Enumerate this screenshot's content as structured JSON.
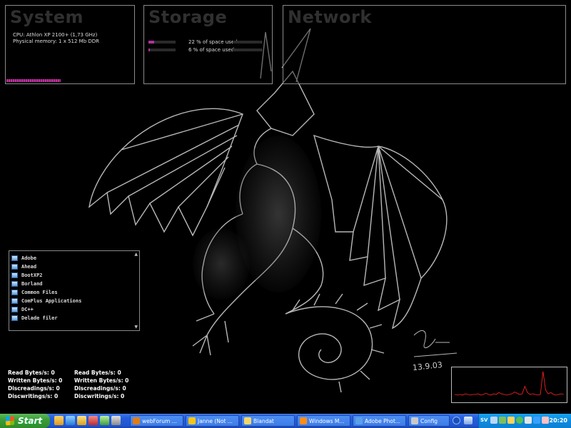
{
  "system": {
    "title": "System",
    "cpu": "CPU: Athlon XP 2100+ (1,73 GHz)",
    "memory": "Physical memory: 1 x 512 Mb DDR"
  },
  "storage": {
    "title": "Storage",
    "disks": [
      {
        "text": "22 % of space used",
        "used_fraction": 0.22
      },
      {
        "text": "6 % of space used",
        "used_fraction": 0.06
      }
    ]
  },
  "network": {
    "title": "Network"
  },
  "folders": [
    "Adobe",
    "Ahead",
    "BootXP2",
    "Borland",
    "Common Files",
    "ComPlus Applications",
    "DC++",
    "Delade filer"
  ],
  "artist_signature": "13.9.03",
  "stats_left": [
    "Read Bytes/s: 0",
    "Written Bytes/s: 0",
    "Discreadings/s: 0",
    "Discwritings/s: 0"
  ],
  "stats_right": [
    "Read Bytes/s: 0",
    "Written Bytes/s: 0",
    "Discreadings/s: 0",
    "Discwritings/s: 0"
  ],
  "net_graph": {
    "values": [
      5,
      4,
      5,
      4,
      6,
      5,
      4,
      5,
      5,
      6,
      4,
      5,
      7,
      5,
      4,
      6,
      5,
      8,
      6,
      5,
      4,
      5,
      6,
      9,
      7,
      5,
      6,
      18,
      8,
      5,
      6,
      5,
      4,
      5,
      42,
      12,
      6,
      8,
      5,
      4,
      5,
      6,
      5
    ],
    "color": "#e0201e"
  },
  "taskbar": {
    "start_label": "Start",
    "tasks": [
      "webForum ...",
      "Janne (Not ...",
      "Blandat",
      "Windows M...",
      "Adobe Phot...",
      "Config"
    ],
    "lang": "SV",
    "clock": "20:20"
  }
}
